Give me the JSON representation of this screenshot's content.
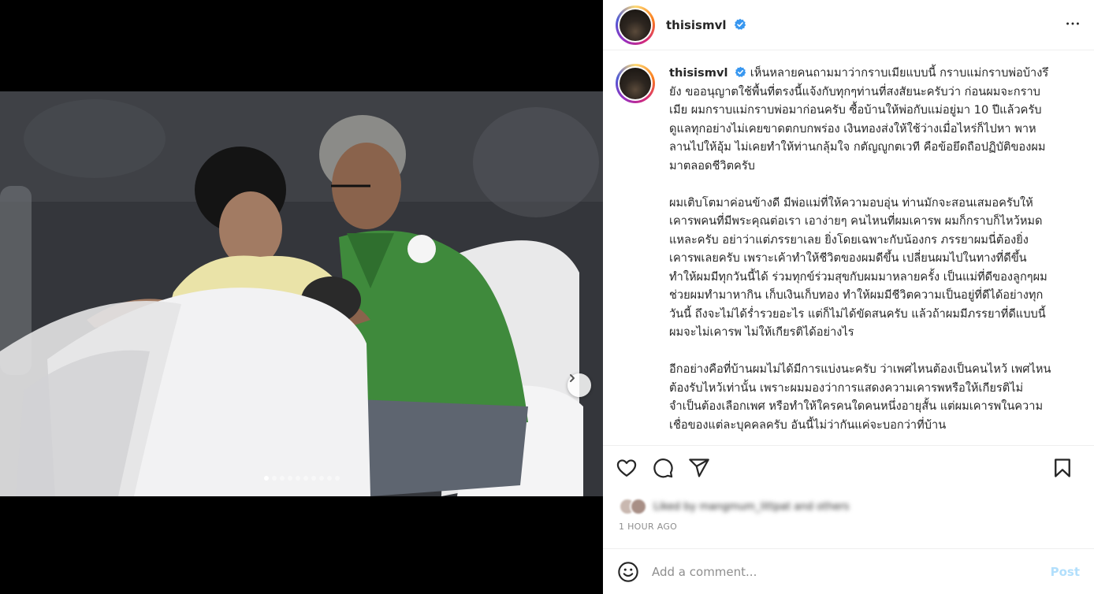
{
  "post": {
    "username": "thisismvl",
    "verified": true,
    "caption_user": "thisismvl",
    "caption_paragraphs": [
      "เห็นหลายคนถามมาว่ากราบเมียแบบนี้ กราบแม่กราบพ่อบ้างรึยัง ขออนุญาตใช้พื้นที่ตรงนี้แจ้งกับทุกๆท่านที่สงสัยนะครับว่า ก่อนผมจะกราบเมีย ผมกราบแม่กราบพ่อมาก่อนครับ ซื้อบ้านให้พ่อกับแม่อยู่มา 10 ปีแล้วครับ ดูแลทุกอย่างไม่เคยขาดตกบกพร่อง เงินทองส่งให้ใช้ว่างเมื่อไหร่ก็ไปหา พาหลานไปให้อุ้ม ไม่เคยทำให้ท่านกลุ้มใจ กตัญญูกตเวที คือข้อยึดถือปฏิบัติของผมมาตลอดชีวิตครับ",
      "ผมเติบโตมาค่อนข้างดี มีพ่อแม่ที่ให้ความอบอุ่น ท่านมักจะสอนเสมอครับให้เคารพคนที่มีพระคุณต่อเรา เอาง่ายๆ คนไหนที่ผมเคารพ ผมก็กราบก็ไหว้หมดแหละครับ อย่าว่าแต่ภรรยาเลย ยิ่งโดยเฉพาะกับน้องกร ภรรยาผมนี่ต้องยิ่งเคารพเลยครับ เพราะเค้าทำให้ชีวิตของผมดีขึ้น เปลี่ยนผมไปในทางที่ดีขึ้น ทำให้ผมมีทุกวันนี้ได้ ร่วมทุกข์ร่วมสุขกับผมมาหลายครั้ง เป็นแม่ที่ดีของลูกๆผม ช่วยผมทำมาหากิน เก็บเงินเก็บทอง ทำให้ผมมีชีวิตความเป็นอยู่ที่ดีได้อย่างทุกวันนี้ ถึงจะไม่ได้ร่ำรวยอะไร แต่ก็ไม่ได้ขัดสนครับ แล้วถ้าผมมีภรรยาที่ดีแบบนี้ ผมจะไม่เคารพ ไม่ให้เกียรติได้อย่างไร",
      "อีกอย่างคือที่บ้านผมไม่ได้มีการแบ่งนะครับ ว่าเพศไหนต้องเป็นคนไหว้ เพศไหนต้องรับไหว้เท่านั้น เพราะผมมองว่าการแสดงความเคารพหรือให้เกียรติไม่จำเป็นต้องเลือกเพศ หรือทำให้ใครคนใดคนหนึ่งอายุสั้น แต่ผมเคารพในความเชื่อของแต่ละบุคคลครับ อันนี้ไม่ว่ากันแค่จะบอกว่าที่บ้าน"
    ],
    "likes_text": "Liked by mangmum_littpat and others",
    "timestamp": "1 HOUR AGO",
    "comment_placeholder": "Add a comment...",
    "post_label": "Post",
    "carousel_count": 10,
    "carousel_active": 0
  },
  "icons": {
    "more": "more-horizontal-icon",
    "like": "heart-icon",
    "comment": "comment-icon",
    "share": "send-icon",
    "save": "bookmark-icon",
    "emoji": "emoji-icon",
    "next": "chevron-right-icon",
    "verified": "verified-badge-icon"
  },
  "colors": {
    "verified": "#3897f0",
    "post_button": "#b2dffc",
    "muted": "#8e8e8e"
  }
}
